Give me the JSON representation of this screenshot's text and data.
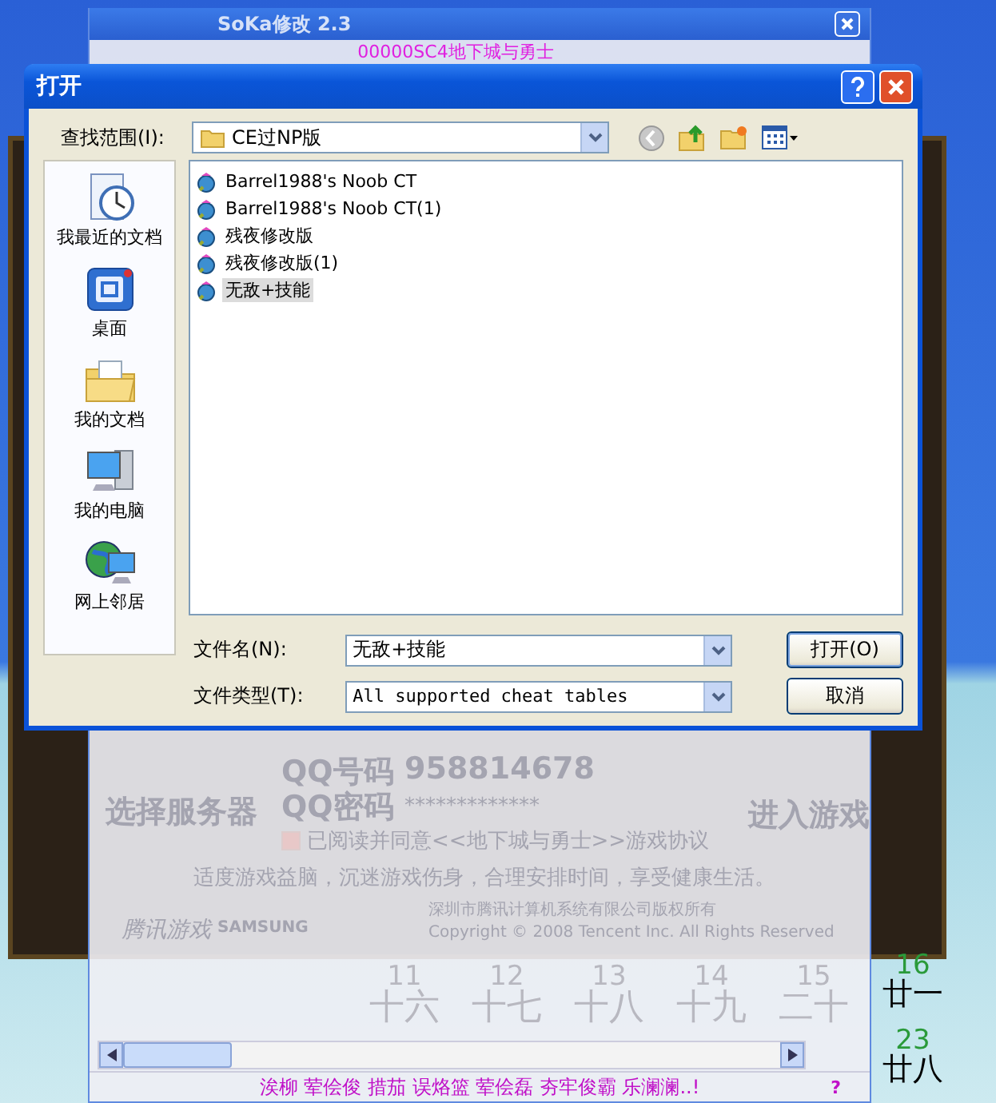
{
  "background_window": {
    "title": "SoKa修改 2.3",
    "banner": "00000SC4地下城与勇士",
    "game": {
      "server_button": "选择服务器",
      "qq_label": "QQ号码",
      "qq_value": "958814678",
      "password_label": "QQ密码",
      "password_value": "*************",
      "agreement": "已阅读并同意<<地下城与勇士>>游戏协议",
      "agreement_checked": true,
      "enter_button": "进入游戏",
      "notice": "适度游戏益脑，沉迷游戏伤身，合理安排时间，享受健康生活。",
      "brand": "腾讯游戏",
      "sponsor": "SAMSUNG",
      "company": "深圳市腾讯计算机系统有限公司版权所有",
      "copyright": "Copyright © 2008 Tencent Inc. All Rights Reserved"
    },
    "calendar": [
      {
        "day": "11",
        "lunar": "十六"
      },
      {
        "day": "12",
        "lunar": "十七"
      },
      {
        "day": "13",
        "lunar": "十八"
      },
      {
        "day": "14",
        "lunar": "十九"
      },
      {
        "day": "15",
        "lunar": "二十"
      }
    ],
    "status_text": "涘柳 荤侩俊 措茄 误烙篮 荤侩磊 夯牢俊霸 乐澜澜..!",
    "help": "?"
  },
  "desktop_calendar": [
    {
      "day": "16",
      "lunar": "廿一"
    },
    {
      "day": "23",
      "lunar": "廿八"
    }
  ],
  "dialog": {
    "title": "打开",
    "look_in_label": "查找范围(I):",
    "look_in_value": "CE过NP版",
    "places": [
      {
        "label": "我最近的文档",
        "kind": "recent"
      },
      {
        "label": "桌面",
        "kind": "desktop"
      },
      {
        "label": "我的文档",
        "kind": "documents"
      },
      {
        "label": "我的电脑",
        "kind": "computer"
      },
      {
        "label": "网上邻居",
        "kind": "network"
      }
    ],
    "files": [
      {
        "name": "Barrel1988's Noob CT",
        "selected": false
      },
      {
        "name": "Barrel1988's Noob CT(1)",
        "selected": false
      },
      {
        "name": "残夜修改版",
        "selected": false
      },
      {
        "name": "残夜修改版(1)",
        "selected": false
      },
      {
        "name": "无敌+技能",
        "selected": true
      }
    ],
    "file_name_label": "文件名(N):",
    "file_name_value": "无敌+技能",
    "file_type_label": "文件类型(T):",
    "file_type_value": "All supported cheat tables",
    "open_button": "打开(O)",
    "cancel_button": "取消"
  }
}
